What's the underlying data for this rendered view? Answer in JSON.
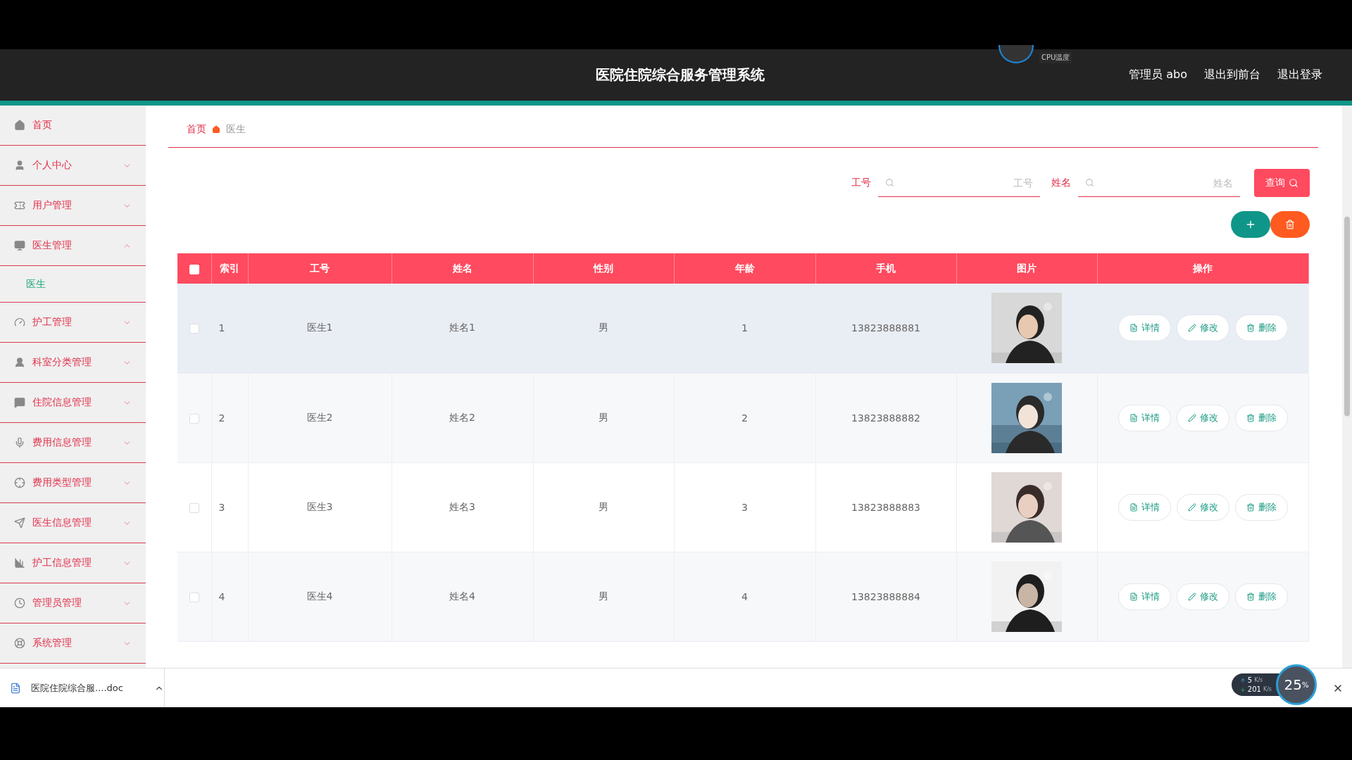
{
  "header": {
    "title": "医院住院综合服务管理系统",
    "cpu_label": "CPU温度",
    "user": "管理员 abo",
    "links": [
      "退出到前台",
      "退出登录"
    ]
  },
  "sidebar": {
    "items": [
      {
        "label": "首页",
        "kind": "link"
      },
      {
        "label": "个人中心",
        "kind": "menu",
        "expanded": false
      },
      {
        "label": "用户管理",
        "kind": "menu",
        "expanded": false
      },
      {
        "label": "医生管理",
        "kind": "menu",
        "expanded": true,
        "children": [
          {
            "label": "医生",
            "selected": true
          }
        ]
      },
      {
        "label": "护工管理",
        "kind": "menu",
        "expanded": false
      },
      {
        "label": "科室分类管理",
        "kind": "menu",
        "expanded": false
      },
      {
        "label": "住院信息管理",
        "kind": "menu",
        "expanded": false
      },
      {
        "label": "费用信息管理",
        "kind": "menu",
        "expanded": false
      },
      {
        "label": "费用类型管理",
        "kind": "menu",
        "expanded": false
      },
      {
        "label": "医生信息管理",
        "kind": "menu",
        "expanded": false
      },
      {
        "label": "护工信息管理",
        "kind": "menu",
        "expanded": false
      },
      {
        "label": "管理员管理",
        "kind": "menu",
        "expanded": false
      },
      {
        "label": "系统管理",
        "kind": "menu",
        "expanded": false
      }
    ]
  },
  "breadcrumb": [
    "首页",
    "医生"
  ],
  "search": {
    "fields": [
      {
        "label": "工号",
        "placeholder": "工号"
      },
      {
        "label": "姓名",
        "placeholder": "姓名"
      }
    ],
    "button": "查询"
  },
  "table": {
    "select_all": false,
    "columns": [
      "索引",
      "工号",
      "姓名",
      "性别",
      "年龄",
      "手机",
      "图片",
      "操作"
    ],
    "rows": [
      {
        "checked": false,
        "hovered": true,
        "cells": [
          "1",
          "医生1",
          "姓名1",
          "男",
          "1",
          "13823888881"
        ],
        "photo": {
          "kind": "picture"
        },
        "actions": [
          "详情",
          "修改",
          "删除"
        ]
      },
      {
        "checked": false,
        "hovered": false,
        "cells": [
          "2",
          "医生2",
          "姓名2",
          "男",
          "2",
          "13823888882"
        ],
        "photo": {
          "kind": "picture"
        },
        "actions": [
          "详情",
          "修改",
          "删除"
        ]
      },
      {
        "checked": false,
        "hovered": false,
        "cells": [
          "3",
          "医生3",
          "姓名3",
          "男",
          "3",
          "13823888883"
        ],
        "photo": {
          "kind": "picture"
        },
        "actions": [
          "详情",
          "修改",
          "删除"
        ]
      },
      {
        "checked": false,
        "hovered": false,
        "cells": [
          "4",
          "医生4",
          "姓名4",
          "男",
          "4",
          "13823888884"
        ],
        "photo": {
          "kind": "picture"
        },
        "actions": [
          "详情",
          "修改",
          "删除"
        ]
      }
    ]
  },
  "download_bar": {
    "file": "医院住院综合服....doc"
  },
  "net_widget": {
    "up": "5",
    "down": "201",
    "up_unit": "K/s",
    "down_unit": "K/s",
    "percent": "25",
    "percent_sign": "%"
  }
}
